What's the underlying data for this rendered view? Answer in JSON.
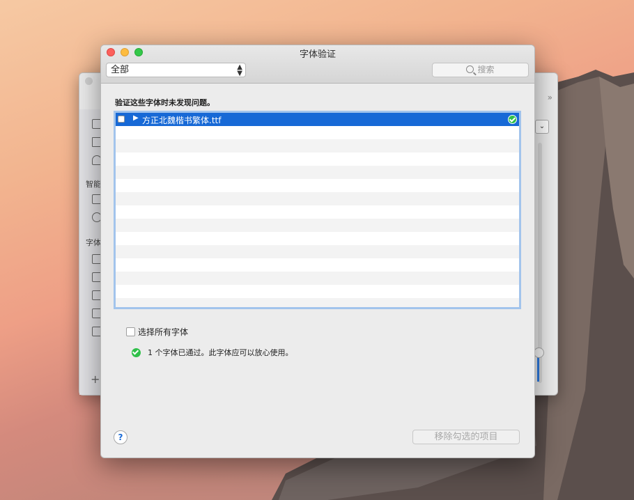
{
  "dialog": {
    "title": "字体验证",
    "filter_value": "全部",
    "search_placeholder": "搜索",
    "message": "验证这些字体时未发现问题。",
    "fonts": [
      {
        "name": "方正北魏楷书繁体.ttf",
        "status": "passed"
      }
    ],
    "select_all_label": "选择所有字体",
    "status_text": "1 个字体已通过。此字体应可以放心使用。",
    "remove_button": "移除勾选的项目",
    "help_label": "?"
  },
  "background_window": {
    "sidebar_labels": [
      "智能",
      "字体"
    ]
  },
  "colors": {
    "selection": "#1769d6",
    "ok_green": "#30c04a",
    "close": "#fc605c",
    "minimize": "#fdbc40",
    "maximize": "#34c84a"
  }
}
